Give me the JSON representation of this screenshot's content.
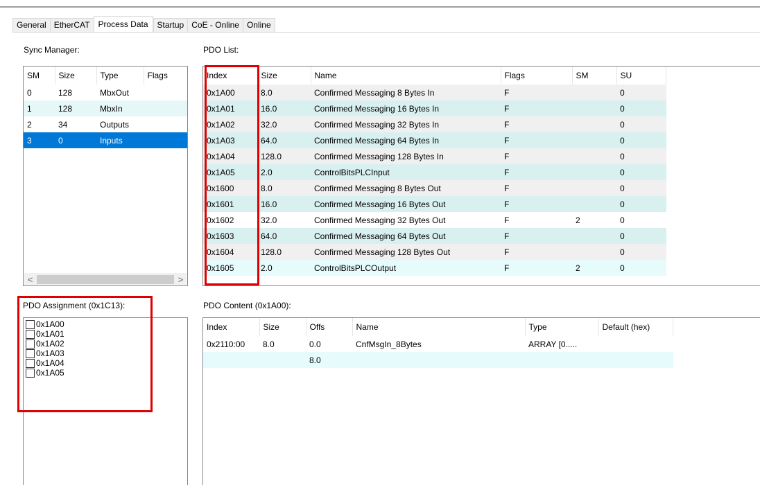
{
  "tabs": [
    "General",
    "EtherCAT",
    "Process Data",
    "Startup",
    "CoE - Online",
    "Online"
  ],
  "active_tab": "Process Data",
  "sync_manager": {
    "label": "Sync Manager:",
    "columns": [
      "SM",
      "Size",
      "Type",
      "Flags"
    ],
    "rows": [
      {
        "sm": "0",
        "size": "128",
        "type": "MbxOut",
        "flags": ""
      },
      {
        "sm": "1",
        "size": "128",
        "type": "MbxIn",
        "flags": ""
      },
      {
        "sm": "2",
        "size": "34",
        "type": "Outputs",
        "flags": ""
      },
      {
        "sm": "3",
        "size": "0",
        "type": "Inputs",
        "flags": ""
      }
    ],
    "selected_row": 3,
    "scroll_left": "<",
    "scroll_right": ">"
  },
  "pdo_list": {
    "label": "PDO List:",
    "columns": [
      "Index",
      "Size",
      "Name",
      "Flags",
      "SM",
      "SU"
    ],
    "rows": [
      {
        "index": "0x1A00",
        "size": "8.0",
        "name": "Confirmed Messaging 8 Bytes In",
        "flags": "F",
        "sm": "",
        "su": "0"
      },
      {
        "index": "0x1A01",
        "size": "16.0",
        "name": "Confirmed Messaging 16 Bytes In",
        "flags": "F",
        "sm": "",
        "su": "0"
      },
      {
        "index": "0x1A02",
        "size": "32.0",
        "name": "Confirmed Messaging 32 Bytes In",
        "flags": "F",
        "sm": "",
        "su": "0"
      },
      {
        "index": "0x1A03",
        "size": "64.0",
        "name": "Confirmed Messaging 64 Bytes In",
        "flags": "F",
        "sm": "",
        "su": "0"
      },
      {
        "index": "0x1A04",
        "size": "128.0",
        "name": "Confirmed Messaging 128 Bytes In",
        "flags": "F",
        "sm": "",
        "su": "0"
      },
      {
        "index": "0x1A05",
        "size": "2.0",
        "name": "ControlBitsPLCInput",
        "flags": "F",
        "sm": "",
        "su": "0"
      },
      {
        "index": "0x1600",
        "size": "8.0",
        "name": "Confirmed Messaging 8 Bytes Out",
        "flags": "F",
        "sm": "",
        "su": "0"
      },
      {
        "index": "0x1601",
        "size": "16.0",
        "name": "Confirmed Messaging 16 Bytes Out",
        "flags": "F",
        "sm": "",
        "su": "0"
      },
      {
        "index": "0x1602",
        "size": "32.0",
        "name": "Confirmed Messaging 32 Bytes Out",
        "flags": "F",
        "sm": "2",
        "su": "0"
      },
      {
        "index": "0x1603",
        "size": "64.0",
        "name": "Confirmed Messaging 64 Bytes Out",
        "flags": "F",
        "sm": "",
        "su": "0"
      },
      {
        "index": "0x1604",
        "size": "128.0",
        "name": "Confirmed Messaging 128 Bytes Out",
        "flags": "F",
        "sm": "",
        "su": "0"
      },
      {
        "index": "0x1605",
        "size": "2.0",
        "name": "ControlBitsPLCOutput",
        "flags": "F",
        "sm": "2",
        "su": "0"
      }
    ]
  },
  "pdo_assignment": {
    "label": "PDO Assignment (0x1C13):",
    "items": [
      "0x1A00",
      "0x1A01",
      "0x1A02",
      "0x1A03",
      "0x1A04",
      "0x1A05"
    ]
  },
  "pdo_content": {
    "label": "PDO Content (0x1A00):",
    "columns": [
      "Index",
      "Size",
      "Offs",
      "Name",
      "Type",
      "Default (hex)"
    ],
    "rows": [
      {
        "index": "0x2110:00",
        "size": "8.0",
        "offs": "0.0",
        "name": "CnfMsgIn_8Bytes",
        "type": "ARRAY [0.....",
        "default": ""
      },
      {
        "index": "",
        "size": "",
        "offs": "8.0",
        "name": "",
        "type": "",
        "default": ""
      }
    ]
  },
  "colors": {
    "highlight": "#e00000",
    "selection": "#0078d7",
    "row_alt": "#d9f0f0"
  }
}
